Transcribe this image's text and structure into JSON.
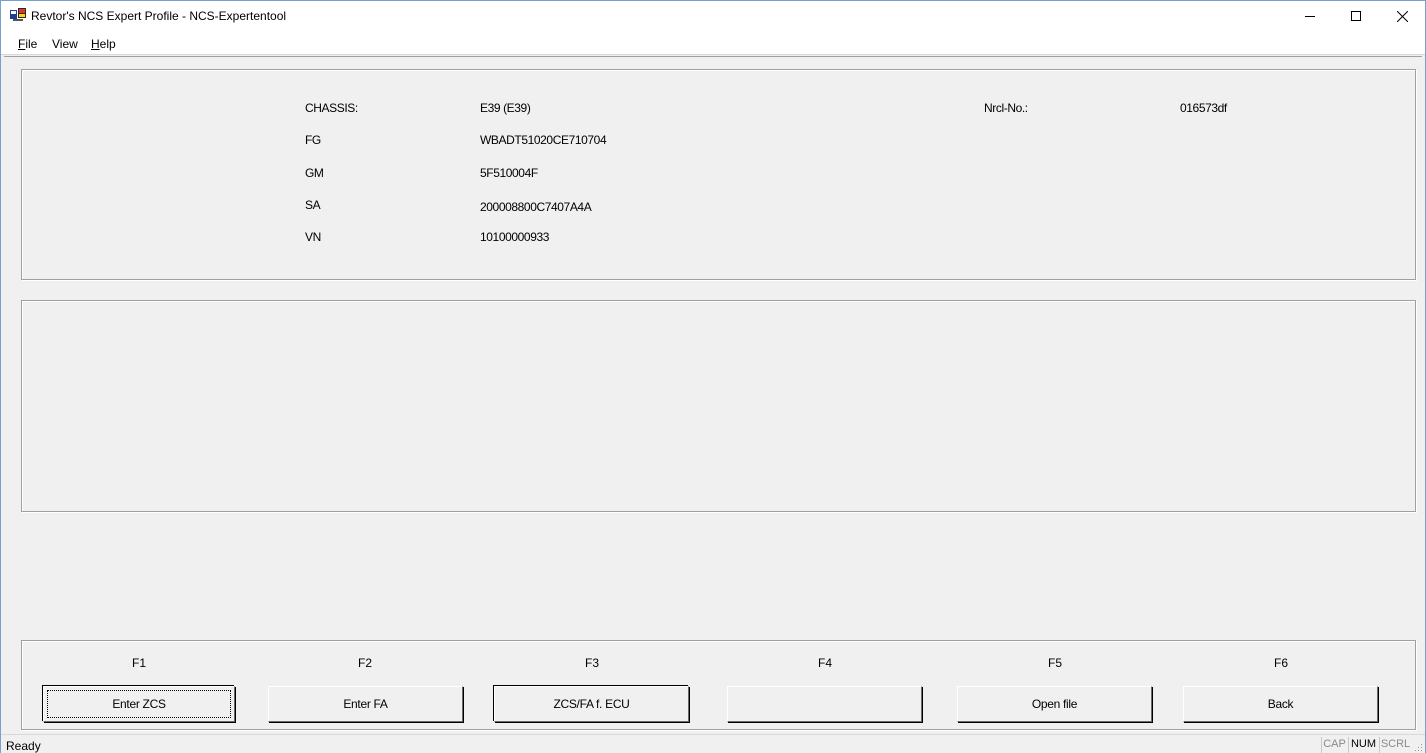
{
  "window": {
    "title": "Revtor's NCS Expert Profile - NCS-Expertentool"
  },
  "menu": {
    "file": {
      "mnemonic": "F",
      "rest": "ile"
    },
    "view": {
      "label": "View"
    },
    "help": {
      "mnemonic": "H",
      "rest": "elp"
    }
  },
  "info": {
    "fields": [
      {
        "label": "CHASSIS:",
        "value": "E39 (E39)"
      },
      {
        "label": "FG",
        "value": "WBADT51020CE710704"
      },
      {
        "label": "GM",
        "value": "5F510004F"
      },
      {
        "label": "SA",
        "value": "200008800C7407A4A"
      },
      {
        "label": "VN",
        "value": "10100000933"
      }
    ],
    "nrcl_label": "Nrcl-No.:",
    "nrcl_value": "016573df"
  },
  "fkeys": [
    {
      "key": "F1",
      "label": "Enter ZCS"
    },
    {
      "key": "F2",
      "label": "Enter FA"
    },
    {
      "key": "F3",
      "label": "ZCS/FA f. ECU"
    },
    {
      "key": "F4",
      "label": ""
    },
    {
      "key": "F5",
      "label": "Open file"
    },
    {
      "key": "F6",
      "label": "Back"
    }
  ],
  "status": {
    "text": "Ready",
    "cap": "CAP",
    "num": "NUM",
    "scrl": "SCRL"
  }
}
